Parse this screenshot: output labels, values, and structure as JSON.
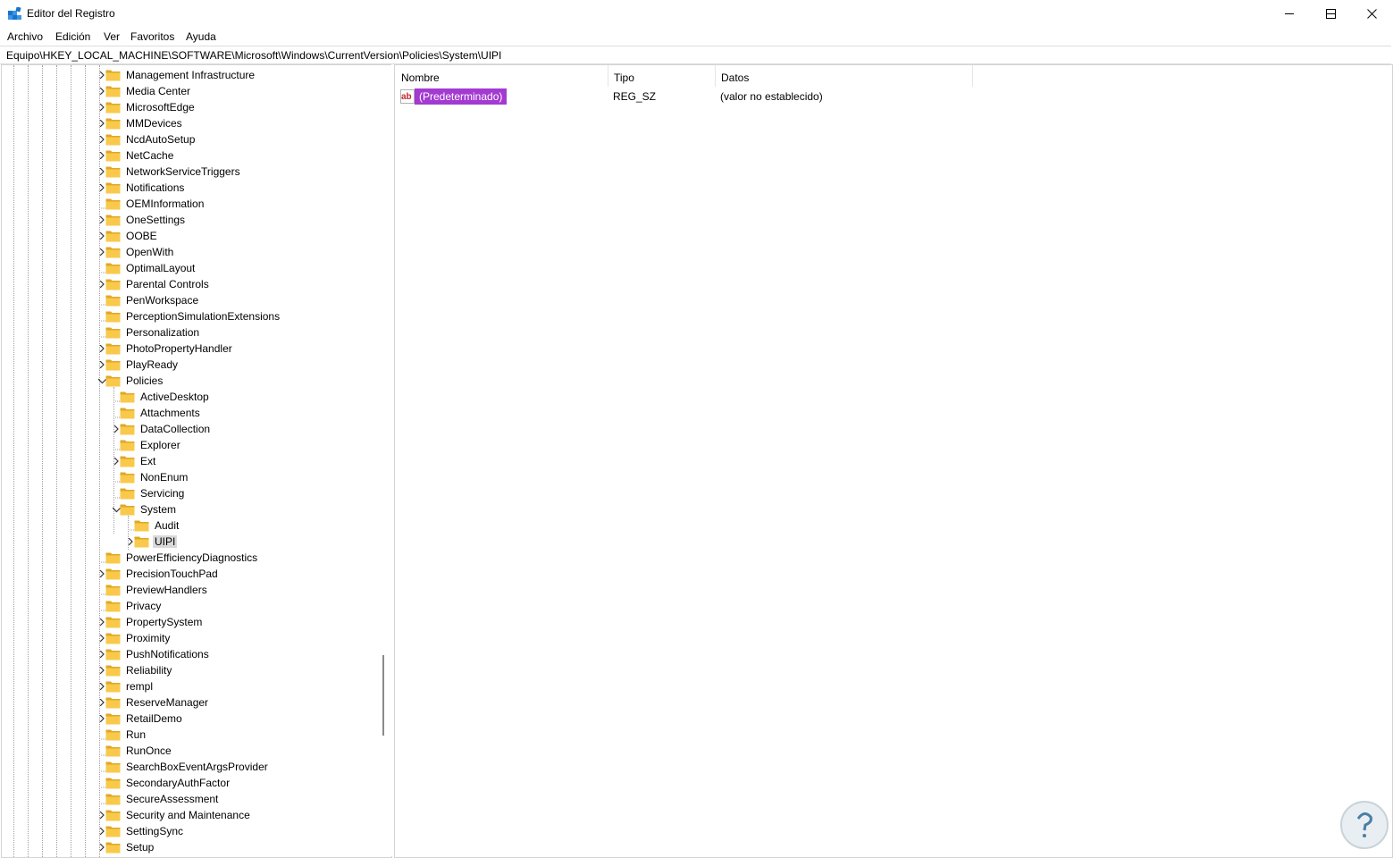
{
  "window": {
    "title": "Editor del Registro",
    "minimize_glyph": "—",
    "maximize_glyph": "☐",
    "close_glyph": "✕"
  },
  "menu": [
    "Archivo",
    "Edición",
    "Ver",
    "Favoritos",
    "Ayuda"
  ],
  "address": "Equipo\\HKEY_LOCAL_MACHINE\\SOFTWARE\\Microsoft\\Windows\\CurrentVersion\\Policies\\System\\UIPI",
  "tree": [
    {
      "label": "Management Infrastructure",
      "expander": "collapsed",
      "depth": 0
    },
    {
      "label": "Media Center",
      "expander": "collapsed",
      "depth": 0
    },
    {
      "label": "MicrosoftEdge",
      "expander": "collapsed",
      "depth": 0
    },
    {
      "label": "MMDevices",
      "expander": "collapsed",
      "depth": 0
    },
    {
      "label": "NcdAutoSetup",
      "expander": "collapsed",
      "depth": 0
    },
    {
      "label": "NetCache",
      "expander": "collapsed",
      "depth": 0
    },
    {
      "label": "NetworkServiceTriggers",
      "expander": "collapsed",
      "depth": 0
    },
    {
      "label": "Notifications",
      "expander": "collapsed",
      "depth": 0
    },
    {
      "label": "OEMInformation",
      "expander": "none",
      "depth": 0
    },
    {
      "label": "OneSettings",
      "expander": "collapsed",
      "depth": 0
    },
    {
      "label": "OOBE",
      "expander": "collapsed",
      "depth": 0
    },
    {
      "label": "OpenWith",
      "expander": "collapsed",
      "depth": 0
    },
    {
      "label": "OptimalLayout",
      "expander": "none",
      "depth": 0
    },
    {
      "label": "Parental Controls",
      "expander": "collapsed",
      "depth": 0
    },
    {
      "label": "PenWorkspace",
      "expander": "none",
      "depth": 0
    },
    {
      "label": "PerceptionSimulationExtensions",
      "expander": "none",
      "depth": 0
    },
    {
      "label": "Personalization",
      "expander": "none",
      "depth": 0
    },
    {
      "label": "PhotoPropertyHandler",
      "expander": "collapsed",
      "depth": 0
    },
    {
      "label": "PlayReady",
      "expander": "collapsed",
      "depth": 0
    },
    {
      "label": "Policies",
      "expander": "expanded",
      "depth": 0
    },
    {
      "label": "ActiveDesktop",
      "expander": "none",
      "depth": 1
    },
    {
      "label": "Attachments",
      "expander": "none",
      "depth": 1
    },
    {
      "label": "DataCollection",
      "expander": "collapsed",
      "depth": 1
    },
    {
      "label": "Explorer",
      "expander": "none",
      "depth": 1
    },
    {
      "label": "Ext",
      "expander": "collapsed",
      "depth": 1
    },
    {
      "label": "NonEnum",
      "expander": "none",
      "depth": 1
    },
    {
      "label": "Servicing",
      "expander": "none",
      "depth": 1
    },
    {
      "label": "System",
      "expander": "expanded",
      "depth": 1
    },
    {
      "label": "Audit",
      "expander": "none",
      "depth": 2
    },
    {
      "label": "UIPI",
      "expander": "collapsed",
      "depth": 2,
      "selected": true
    },
    {
      "label": "PowerEfficiencyDiagnostics",
      "expander": "none",
      "depth": 0
    },
    {
      "label": "PrecisionTouchPad",
      "expander": "collapsed",
      "depth": 0
    },
    {
      "label": "PreviewHandlers",
      "expander": "none",
      "depth": 0
    },
    {
      "label": "Privacy",
      "expander": "none",
      "depth": 0
    },
    {
      "label": "PropertySystem",
      "expander": "collapsed",
      "depth": 0
    },
    {
      "label": "Proximity",
      "expander": "collapsed",
      "depth": 0
    },
    {
      "label": "PushNotifications",
      "expander": "collapsed",
      "depth": 0
    },
    {
      "label": "Reliability",
      "expander": "collapsed",
      "depth": 0
    },
    {
      "label": "rempl",
      "expander": "collapsed",
      "depth": 0
    },
    {
      "label": "ReserveManager",
      "expander": "collapsed",
      "depth": 0
    },
    {
      "label": "RetailDemo",
      "expander": "collapsed",
      "depth": 0
    },
    {
      "label": "Run",
      "expander": "none",
      "depth": 0
    },
    {
      "label": "RunOnce",
      "expander": "none",
      "depth": 0
    },
    {
      "label": "SearchBoxEventArgsProvider",
      "expander": "none",
      "depth": 0
    },
    {
      "label": "SecondaryAuthFactor",
      "expander": "none",
      "depth": 0
    },
    {
      "label": "SecureAssessment",
      "expander": "none",
      "depth": 0
    },
    {
      "label": "Security and Maintenance",
      "expander": "collapsed",
      "depth": 0
    },
    {
      "label": "SettingSync",
      "expander": "collapsed",
      "depth": 0
    },
    {
      "label": "Setup",
      "expander": "collapsed",
      "depth": 0
    }
  ],
  "columns": {
    "name": "Nombre",
    "type": "Tipo",
    "data": "Datos"
  },
  "values": [
    {
      "name": "(Predeterminado)",
      "type": "REG_SZ",
      "data": "(valor no establecido)",
      "icon": "ab-string-icon"
    }
  ],
  "colors": {
    "folder": "#f8c94a",
    "folder_dark": "#e0a823",
    "selection_value": "#a33ad1",
    "selection_tree": "#d9d9d9"
  }
}
